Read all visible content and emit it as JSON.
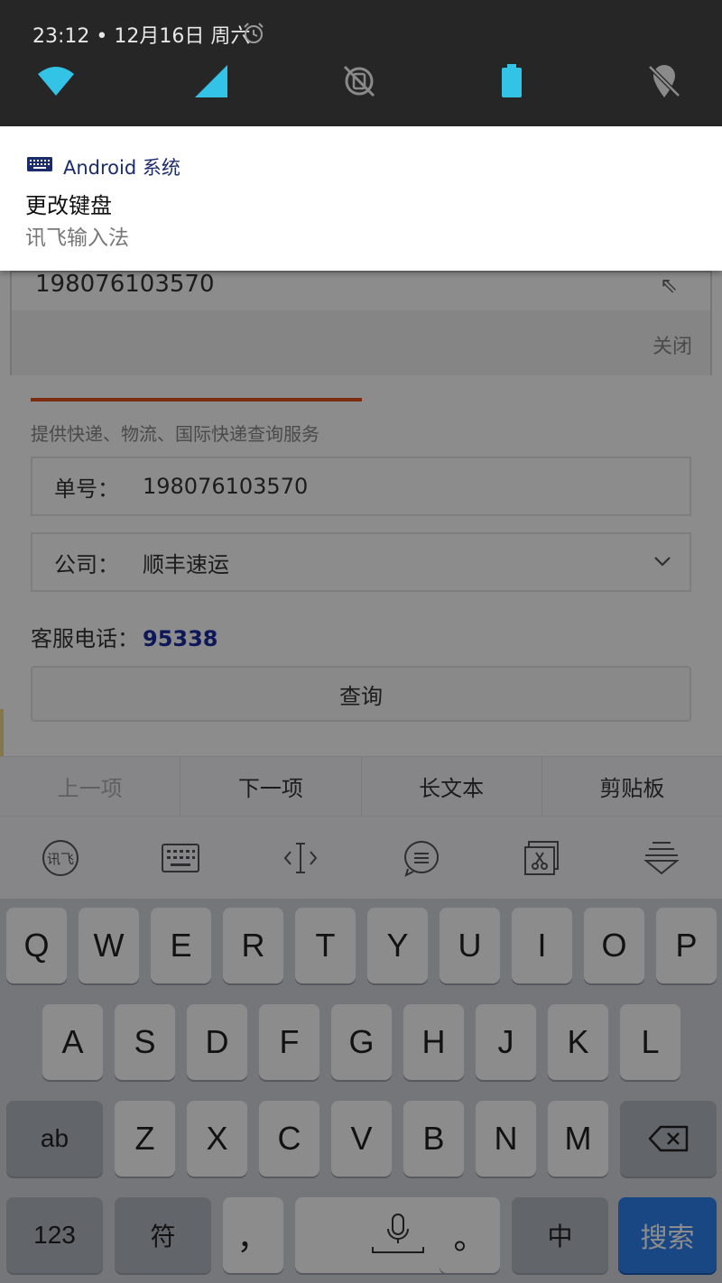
{
  "status_bar": {
    "time_date": "23:12 • 12月16日 周六"
  },
  "notification": {
    "app_name": "Android 系统",
    "title": "更改键盘",
    "text": "讯飞输入法"
  },
  "autocomplete": {
    "suggestion": "198076103570",
    "close_label": "关闭"
  },
  "form": {
    "description": "提供快递、物流、国际快递查询服务",
    "tracking_label": "单号：",
    "tracking_value": "198076103570",
    "company_label": "公司：",
    "company_value": "顺丰速运",
    "hotline_label": "客服电话：",
    "hotline_number": "95338",
    "query_button": "查询"
  },
  "keyboard": {
    "candidates": [
      "上一项",
      "下一项",
      "长文本",
      "剪贴板"
    ],
    "row1": [
      "Q",
      "W",
      "E",
      "R",
      "T",
      "Y",
      "U",
      "I",
      "O",
      "P"
    ],
    "row2": [
      "A",
      "S",
      "D",
      "F",
      "G",
      "H",
      "J",
      "K",
      "L"
    ],
    "row3": [
      "Z",
      "X",
      "C",
      "V",
      "B",
      "N",
      "M"
    ],
    "abc_key": "ab",
    "num_key": "123",
    "symbol_key": "符",
    "comma_key": "，",
    "period_key": "。",
    "lang_key": "中",
    "search_key": "搜索"
  },
  "colors": {
    "accent_orange": "#e2531d",
    "hotline_blue": "#1a2da1",
    "quick_setting_cyan": "#33c3e6",
    "search_key_blue": "#2f82ee"
  }
}
